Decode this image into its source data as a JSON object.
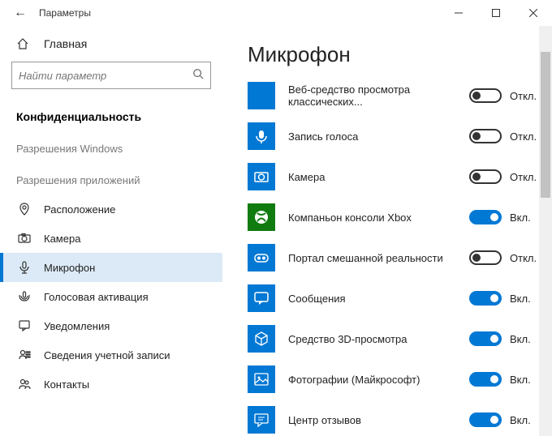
{
  "window": {
    "title": "Параметры"
  },
  "sidebar": {
    "home": "Главная",
    "search_placeholder": "Найти параметр",
    "active_section": "Конфиденциальность",
    "group1_label": "Разрешения Windows",
    "group2_label": "Разрешения приложений",
    "items": [
      {
        "label": "Расположение",
        "icon": "location"
      },
      {
        "label": "Камера",
        "icon": "camera"
      },
      {
        "label": "Микрофон",
        "icon": "microphone"
      },
      {
        "label": "Голосовая активация",
        "icon": "voice"
      },
      {
        "label": "Уведомления",
        "icon": "notification"
      },
      {
        "label": "Сведения учетной записи",
        "icon": "account"
      },
      {
        "label": "Контакты",
        "icon": "contacts"
      }
    ]
  },
  "content": {
    "heading": "Микрофон",
    "state_on": "Вкл.",
    "state_off": "Откл."
  },
  "apps": [
    {
      "name": "Веб-средство просмотра классических...",
      "on": false,
      "icon": "blank"
    },
    {
      "name": "Запись голоса",
      "on": false,
      "icon": "recorder"
    },
    {
      "name": "Камера",
      "on": false,
      "icon": "camera"
    },
    {
      "name": "Компаньон консоли Xbox",
      "on": true,
      "icon": "xbox",
      "color": "green"
    },
    {
      "name": "Портал смешанной реальности",
      "on": false,
      "icon": "mr"
    },
    {
      "name": "Сообщения",
      "on": true,
      "icon": "messages"
    },
    {
      "name": "Средство 3D-просмотра",
      "on": true,
      "icon": "3d"
    },
    {
      "name": "Фотографии (Майкрософт)",
      "on": true,
      "icon": "photos"
    },
    {
      "name": "Центр отзывов",
      "on": true,
      "icon": "feedback"
    }
  ]
}
